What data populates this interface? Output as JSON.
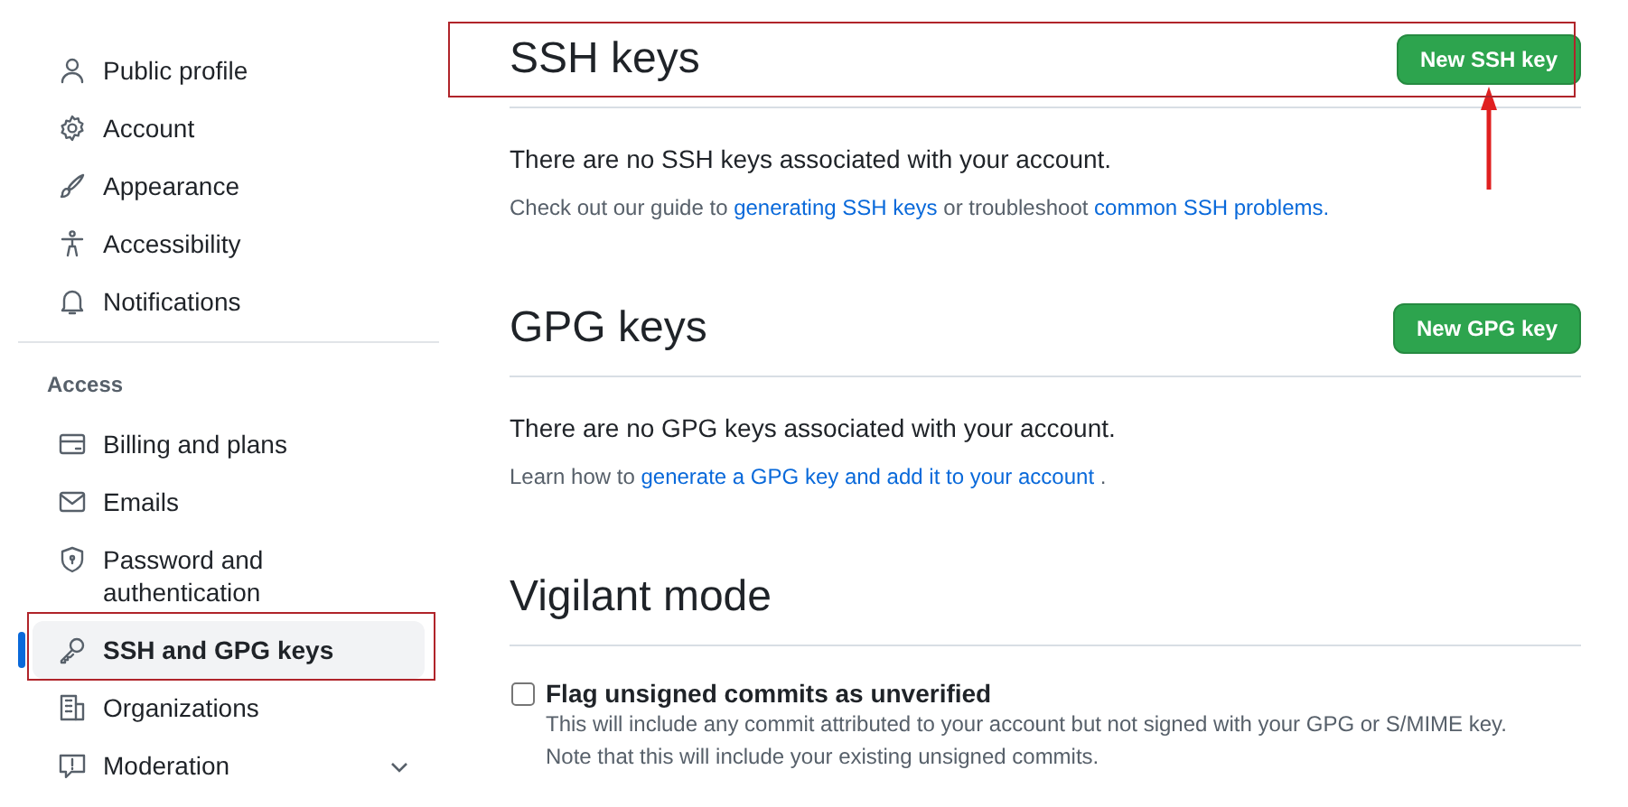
{
  "sidebar": {
    "groups": [
      {
        "items": [
          {
            "label": "Public profile",
            "selected": false
          },
          {
            "label": "Account",
            "selected": false
          },
          {
            "label": "Appearance",
            "selected": false
          },
          {
            "label": "Accessibility",
            "selected": false
          },
          {
            "label": "Notifications",
            "selected": false
          }
        ]
      },
      {
        "heading": "Access",
        "items": [
          {
            "label": "Billing and plans",
            "selected": false
          },
          {
            "label": "Emails",
            "selected": false
          },
          {
            "label": "Password and authentication",
            "selected": false
          },
          {
            "label": "SSH and GPG keys",
            "selected": true,
            "highlighted": true
          },
          {
            "label": "Organizations",
            "selected": false
          },
          {
            "label": "Moderation",
            "selected": false,
            "expanded": false
          }
        ]
      }
    ]
  },
  "sections": [
    {
      "kind": "keys",
      "title": "SSH keys",
      "highlighted": true,
      "button": {
        "label": "New SSH key",
        "pointer": true
      },
      "empty": "There are no SSH keys associated with your account.",
      "help": [
        {
          "text": "Check out our guide to "
        },
        {
          "link": "generating SSH keys"
        },
        {
          "text": " or troubleshoot "
        },
        {
          "link": "common SSH problems."
        }
      ]
    },
    {
      "kind": "keys",
      "title": "GPG keys",
      "button": {
        "label": "New GPG key"
      },
      "empty": "There are no GPG keys associated with your account.",
      "help": [
        {
          "text": "Learn how to "
        },
        {
          "link": "generate a GPG key and add it to your account"
        },
        {
          "text": " ."
        }
      ]
    },
    {
      "kind": "setting",
      "title": "Vigilant mode",
      "option": {
        "label": "Flag unsigned commits as unverified",
        "checked": false,
        "lines": [
          "This will include any commit attributed to your account but not signed with your GPG or S/MIME key.",
          "Note that this will include your existing unsigned commits."
        ]
      }
    }
  ]
}
